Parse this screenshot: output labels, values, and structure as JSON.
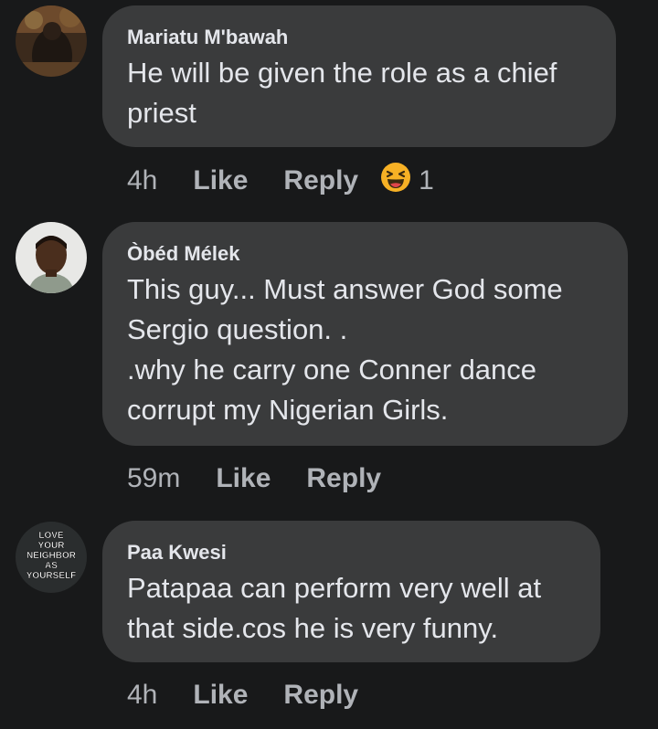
{
  "comments": [
    {
      "author": "Mariatu M'bawah",
      "text": "He will be given the role as a chief\npriest",
      "time": "4h",
      "like_label": "Like",
      "reply_label": "Reply",
      "reaction": {
        "icon": "haha-emoji-icon",
        "count": "1"
      }
    },
    {
      "author": "Òbéd Mélek",
      "text": "This guy... Must answer God some\nSergio question. .\n.why he carry one Conner dance\ncorrupt my Nigerian Girls.",
      "time": "59m",
      "like_label": "Like",
      "reply_label": "Reply"
    },
    {
      "author": "Paa Kwesi",
      "text": "Patapaa can perform very well at\nthat side.cos he is very funny.",
      "time": "4h",
      "like_label": "Like",
      "reply_label": "Reply",
      "avatar_text": [
        "LOVE",
        "YOUR",
        "NEIGHBOR",
        "AS",
        "YOURSELF"
      ]
    }
  ],
  "colors": {
    "background": "#18191a",
    "bubble": "#3a3b3c",
    "primary_text": "#e4e6eb",
    "secondary_text": "#b0b3b8",
    "reaction_yellow": "#f7b125"
  }
}
